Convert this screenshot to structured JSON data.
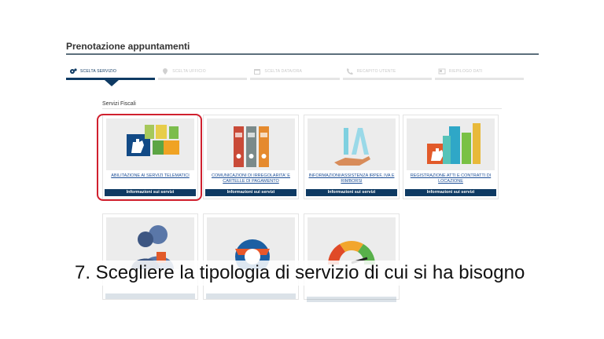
{
  "header": {
    "title": "Prenotazione appuntamenti"
  },
  "steps": [
    {
      "label": "Scelta servizio",
      "icon": "gears-icon"
    },
    {
      "label": "Scelta ufficio",
      "icon": "location-icon"
    },
    {
      "label": "Scelta data/ora",
      "icon": "calendar-icon"
    },
    {
      "label": "Recapito utente",
      "icon": "phone-icon"
    },
    {
      "label": "Riepilogo dati",
      "icon": "card-icon"
    }
  ],
  "section": {
    "title": "Servizi Fiscali"
  },
  "cards": [
    {
      "link": "ABILITAZIONE AI SERVIZI TELEMATICI",
      "button": "Informazioni sui servizi",
      "icon": "hand-grid-icon"
    },
    {
      "link": "COMUNICAZIONI DI IRREGOLARITA' E CARTELLE DI PAGAMENTO",
      "button": "Informazioni sui servizi",
      "icon": "binders-icon"
    },
    {
      "link": "INFORMAZIONI/ASSISTENZA IRPEF, IVA E RIMBORSI",
      "button": "Informazioni sui servizi",
      "icon": "hand-letters-icon"
    },
    {
      "link": "REGISTRAZIONE ATTI E CONTRATTI DI LOCAZIONE",
      "button": "Informazioni sui servizi",
      "icon": "buildings-icon"
    }
  ],
  "caption": {
    "text": "7. Scegliere la tipologia di servizio di cui si ha bisogno"
  }
}
